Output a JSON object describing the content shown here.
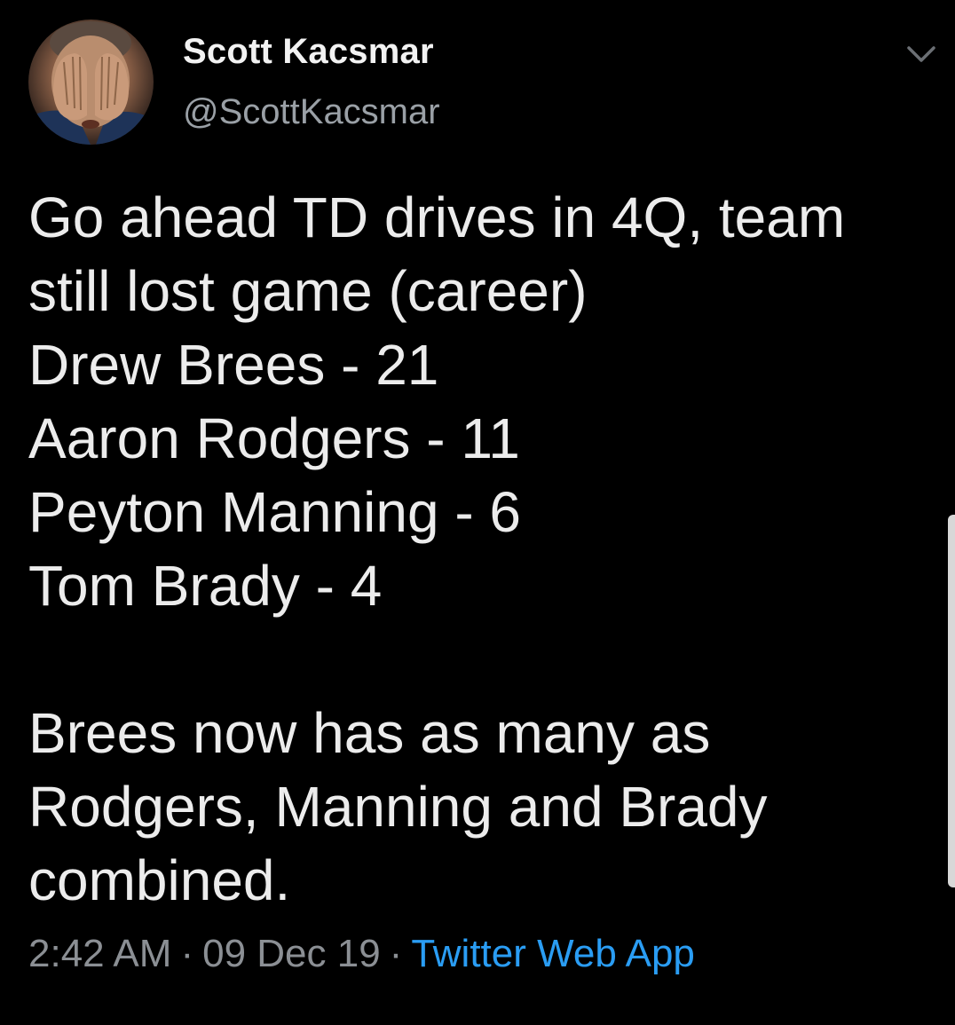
{
  "author": {
    "name": "Scott Kacsmar",
    "handle": "@ScottKacsmar",
    "avatar_icon": "avatar-face-palm"
  },
  "tweet": {
    "lines": [
      "Go ahead TD drives in 4Q, team",
      "still lost game (career)",
      "Drew Brees - 21",
      "Aaron Rodgers - 11",
      "Peyton Manning - 6",
      "Tom Brady - 4",
      "",
      "Brees now has as many as",
      "Rodgers, Manning and Brady",
      "combined."
    ]
  },
  "meta": {
    "time": "2:42 AM",
    "separator": "·",
    "date": "09 Dec 19",
    "source": "Twitter Web App"
  },
  "icons": {
    "menu": "chevron-down-icon"
  },
  "colors": {
    "background": "#000000",
    "text": "#ececec",
    "muted": "#8b8f94",
    "link": "#2a9df4"
  }
}
